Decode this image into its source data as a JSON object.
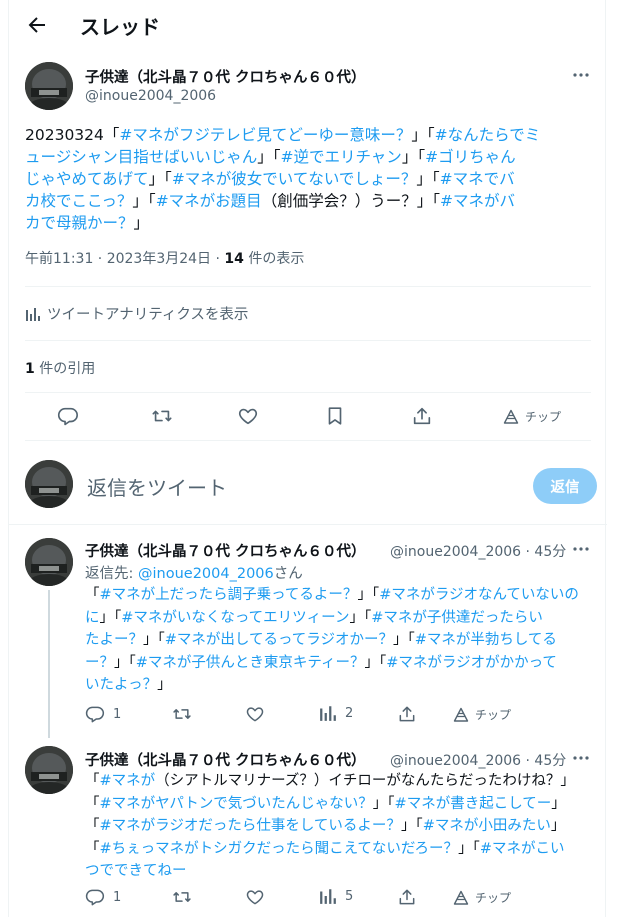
{
  "header": {
    "title": "スレッド"
  },
  "main_tweet": {
    "name": "子供達（北斗晶７０代 クロちゃん６０代）",
    "handle": "@inoue2004_2006",
    "lines": [
      [
        {
          "t": "20230324「",
          "l": false
        },
        {
          "t": "#マネがフジテレビ見てどーゆー意味ー？",
          "l": true
        },
        {
          "t": "」「",
          "l": false
        },
        {
          "t": "#なんたらでミ",
          "l": true
        }
      ],
      [
        {
          "t": "ュージシャン目指せばいいじゃん",
          "l": true
        },
        {
          "t": "」「",
          "l": false
        },
        {
          "t": "#逆でエリチャン",
          "l": true
        },
        {
          "t": "」「",
          "l": false
        },
        {
          "t": "#ゴリちゃん",
          "l": true
        }
      ],
      [
        {
          "t": "じゃやめてあげて",
          "l": true
        },
        {
          "t": "」「",
          "l": false
        },
        {
          "t": "#マネが彼女でいてないでしょー？",
          "l": true
        },
        {
          "t": "」「",
          "l": false
        },
        {
          "t": "#マネでバ",
          "l": true
        }
      ],
      [
        {
          "t": "カ校でここっ？",
          "l": true
        },
        {
          "t": "」「",
          "l": false
        },
        {
          "t": "#マネがお題目",
          "l": true
        },
        {
          "t": "（創価学会？）うー？」「",
          "l": false
        },
        {
          "t": "#マネがバ",
          "l": true
        }
      ],
      [
        {
          "t": "カで母親かー？",
          "l": true
        },
        {
          "t": "」",
          "l": false
        }
      ]
    ],
    "time": "午前11:31 · 2023年3月24日 · ",
    "views_count": "14",
    "views_label": " 件の表示",
    "analytics_label": "ツイートアナリティクスを表示",
    "quote_count": "1",
    "quote_label": " 件の引用",
    "tip_label": "チップ"
  },
  "reply_box": {
    "placeholder": "返信をツイート",
    "button": "返信"
  },
  "replies": [
    {
      "name": "子供達（北斗晶７０代 クロちゃん６０代）",
      "handle": "@inoue2004_2006 · 45分",
      "reply_to_prefix": "返信先: ",
      "reply_to_handle": "@inoue2004_2006",
      "reply_to_suffix": "さん",
      "lines": [
        [
          {
            "t": "「",
            "l": false
          },
          {
            "t": "#マネが上だったら調子乗ってるよー？",
            "l": true
          },
          {
            "t": "」「",
            "l": false
          },
          {
            "t": "#マネがラジオなんていないの",
            "l": true
          }
        ],
        [
          {
            "t": "に",
            "l": true
          },
          {
            "t": "」「",
            "l": false
          },
          {
            "t": "#マネがいなくなってエリツィーン",
            "l": true
          },
          {
            "t": "」「",
            "l": false
          },
          {
            "t": "#マネが子供達だったらい",
            "l": true
          }
        ],
        [
          {
            "t": "たよー？",
            "l": true
          },
          {
            "t": "」「",
            "l": false
          },
          {
            "t": "#マネが出してるってラジオかー？",
            "l": true
          },
          {
            "t": "」「",
            "l": false
          },
          {
            "t": "#マネが半勃ちしてる",
            "l": true
          }
        ],
        [
          {
            "t": "ー？",
            "l": true
          },
          {
            "t": "」「",
            "l": false
          },
          {
            "t": "#マネが子供んとき東京キティー？",
            "l": true
          },
          {
            "t": "」「",
            "l": false
          },
          {
            "t": "#マネがラジオがかかって",
            "l": true
          }
        ],
        [
          {
            "t": "いたよっ？",
            "l": true
          },
          {
            "t": "」",
            "l": false
          }
        ]
      ],
      "reply_count": "1",
      "views": "2",
      "tip_label": "チップ"
    },
    {
      "name": "子供達（北斗晶７０代 クロちゃん６０代）",
      "handle": "@inoue2004_2006 · 45分",
      "lines": [
        [
          {
            "t": "「",
            "l": false
          },
          {
            "t": "#マネが",
            "l": true
          },
          {
            "t": "（シアトルマリナーズ？）イチローがなんたらだったわけね？」",
            "l": false
          }
        ],
        [
          {
            "t": "「",
            "l": false
          },
          {
            "t": "#マネがヤパトンで気づいたんじゃない？",
            "l": true
          },
          {
            "t": "」「",
            "l": false
          },
          {
            "t": "#マネが書き起こしてー",
            "l": true
          },
          {
            "t": "」",
            "l": false
          }
        ],
        [
          {
            "t": "「",
            "l": false
          },
          {
            "t": "#マネがラジオだったら仕事をしているよー？",
            "l": true
          },
          {
            "t": "」「",
            "l": false
          },
          {
            "t": "#マネが小田みたい",
            "l": true
          },
          {
            "t": "」",
            "l": false
          }
        ],
        [
          {
            "t": "「",
            "l": false
          },
          {
            "t": "#ちぇっマネがトシガクだったら聞こえてないだろー？",
            "l": true
          },
          {
            "t": "」「",
            "l": false
          },
          {
            "t": "#マネがこい",
            "l": true
          }
        ],
        [
          {
            "t": "つでできてねー",
            "l": true
          }
        ]
      ],
      "reply_count": "1",
      "views": "5",
      "tip_label": "チップ"
    }
  ]
}
